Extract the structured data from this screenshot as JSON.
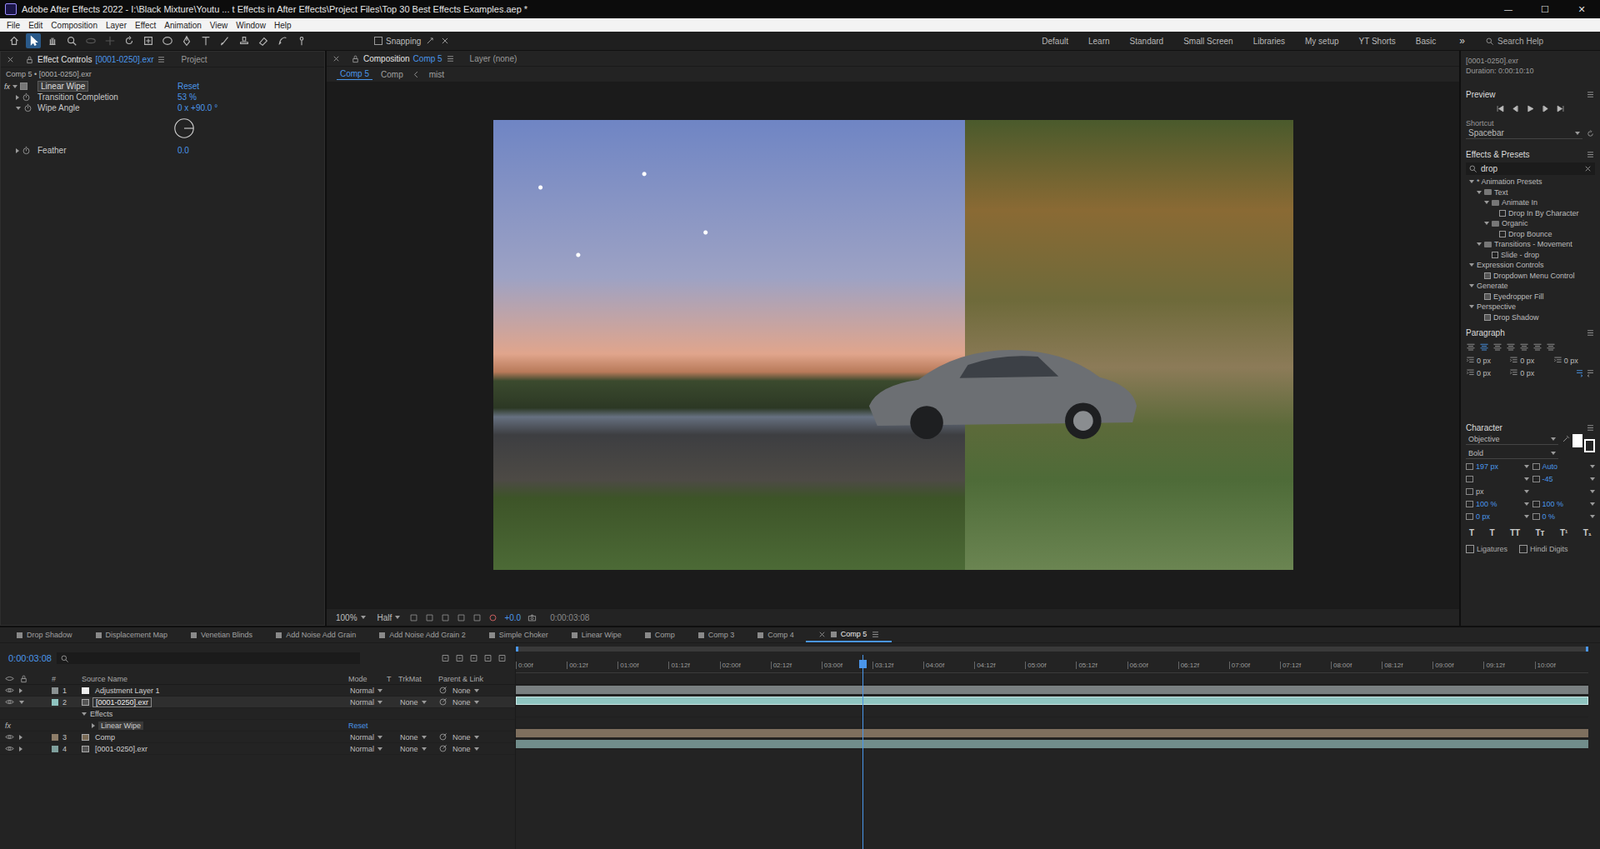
{
  "window": {
    "title": "Adobe After Effects 2022 - I:\\Black Mixture\\Youtu ... t Effects in After Effects\\Project Files\\Top 30 Best Effects Examples.aep *",
    "controls": [
      "—",
      "☐",
      "✕"
    ]
  },
  "menu": [
    "File",
    "Edit",
    "Composition",
    "Layer",
    "Effect",
    "Animation",
    "View",
    "Window",
    "Help"
  ],
  "toolbar": {
    "snapping": {
      "label": "Snapping",
      "checked": false
    },
    "workspaces": [
      {
        "label": "Default",
        "selected": false
      },
      {
        "label": "Learn",
        "selected": false
      },
      {
        "label": "Standard",
        "selected": false
      },
      {
        "label": "Small Screen",
        "selected": false
      },
      {
        "label": "Libraries",
        "selected": false
      },
      {
        "label": "My setup",
        "selected": false
      },
      {
        "label": "YT Shorts",
        "selected": false
      },
      {
        "label": "Basic",
        "selected": false
      }
    ],
    "more": "»",
    "search": "Search Help"
  },
  "effect_controls": {
    "tabs": [
      {
        "label": "Effect Controls",
        "target": "[0001-0250].exr",
        "selected": true
      },
      {
        "label": "Project",
        "target": "",
        "selected": false
      }
    ],
    "layer_path": "Comp 5 • [0001-0250].exr",
    "effect": {
      "badge": "fx",
      "name": "Linear Wipe",
      "reset": "Reset",
      "enabled": true
    },
    "properties": [
      {
        "name": "Transition Completion",
        "value": "53 %",
        "kind": "value",
        "expanded": false
      },
      {
        "name": "Wipe Angle",
        "value": "0 x +90.0 °",
        "kind": "angle",
        "expanded": true
      },
      {
        "name": "Feather",
        "value": "0.0",
        "kind": "value",
        "expanded": false
      }
    ]
  },
  "composition": {
    "tabs": [
      {
        "label": "Composition",
        "target": "Comp 5",
        "selected": true
      },
      {
        "label": "Layer (none)",
        "target": "",
        "selected": false
      }
    ],
    "breadcrumbs": [
      {
        "label": "Comp 5",
        "selected": true
      },
      {
        "label": "Comp",
        "selected": false
      },
      {
        "label": "mist",
        "selected": false
      }
    ],
    "wipe_level": 0.59,
    "footer": {
      "zoom": "100%",
      "resolution": "Half",
      "exposure": "+0.0",
      "time": "0:00:03:08"
    }
  },
  "info": {
    "name": "[0001-0250].exr",
    "duration": "Duration: 0:00:10:10"
  },
  "preview": {
    "title": "Preview",
    "shortcut_label": "Shortcut",
    "shortcut": "Spacebar"
  },
  "effects_presets": {
    "title": "Effects & Presets",
    "search": "drop",
    "tree": [
      {
        "label": "* Animation Presets",
        "depth": 0,
        "kind": "category",
        "expanded": true
      },
      {
        "label": "Text",
        "depth": 1,
        "kind": "folder",
        "expanded": true
      },
      {
        "label": "Animate In",
        "depth": 2,
        "kind": "folder",
        "expanded": true
      },
      {
        "label": "Drop In By Character",
        "depth": 3,
        "kind": "preset",
        "expanded": false
      },
      {
        "label": "Organic",
        "depth": 2,
        "kind": "folder",
        "expanded": true
      },
      {
        "label": "Drop Bounce",
        "depth": 3,
        "kind": "preset",
        "expanded": false
      },
      {
        "label": "Transitions - Movement",
        "depth": 1,
        "kind": "folder",
        "expanded": true
      },
      {
        "label": "Slide - drop",
        "depth": 2,
        "kind": "preset",
        "expanded": false
      },
      {
        "label": "Expression Controls",
        "depth": 0,
        "kind": "category",
        "expanded": true
      },
      {
        "label": "Dropdown Menu Control",
        "depth": 1,
        "kind": "effect",
        "expanded": false
      },
      {
        "label": "Generate",
        "depth": 0,
        "kind": "category",
        "expanded": true
      },
      {
        "label": "Eyedropper Fill",
        "depth": 1,
        "kind": "effect",
        "expanded": false
      },
      {
        "label": "Perspective",
        "depth": 0,
        "kind": "category",
        "expanded": true
      },
      {
        "label": "Drop Shadow",
        "depth": 1,
        "kind": "effect",
        "expanded": false
      }
    ]
  },
  "paragraph": {
    "title": "Paragraph",
    "fields": [
      "0 px",
      "0 px",
      "0 px",
      "0 px",
      "0 px"
    ]
  },
  "character": {
    "title": "Character",
    "font": "Objective",
    "style": "Bold",
    "size": "197 px",
    "leading": "Auto",
    "tracking": "-45",
    "stroke_width": "px",
    "vertical_scale": "100 %",
    "horizontal_scale": "100 %",
    "baseline_shift": "0 px",
    "tsume": "0 %",
    "style_buttons": [
      "T",
      "T",
      "TT",
      "Tт",
      "T¹",
      "T₁"
    ],
    "options": [
      {
        "label": "Ligatures",
        "checked": false
      },
      {
        "label": "Hindi Digits",
        "checked": false
      }
    ]
  },
  "timeline": {
    "tabs": [
      {
        "label": "Drop Shadow",
        "selected": false
      },
      {
        "label": "Displacement Map",
        "selected": false
      },
      {
        "label": "Venetian Blinds",
        "selected": false
      },
      {
        "label": "Add Noise Add Grain",
        "selected": false
      },
      {
        "label": "Add Noise Add Grain 2",
        "selected": false
      },
      {
        "label": "Simple Choker",
        "selected": false
      },
      {
        "label": "Linear Wipe",
        "selected": false
      },
      {
        "label": "Comp",
        "selected": false
      },
      {
        "label": "Comp 3",
        "selected": false
      },
      {
        "label": "Comp 4",
        "selected": false
      },
      {
        "label": "Comp 5",
        "selected": true
      }
    ],
    "time": "0:00:03:08",
    "columns": [
      "#",
      "Source Name",
      "Mode",
      "T",
      "TrkMat",
      "Parent & Link"
    ],
    "rows": [
      {
        "kind": "layer",
        "num": "1",
        "source": "adjustment",
        "name": "Adjustment Layer 1",
        "mode": "Normal",
        "trkmat": "",
        "parent": "None",
        "selected": false,
        "expanded": false,
        "visible": true,
        "color": "#8a9192"
      },
      {
        "kind": "layer",
        "num": "2",
        "source": "footage",
        "name": "[0001-0250].exr",
        "mode": "Normal",
        "trkmat": "None",
        "parent": "None",
        "selected": true,
        "expanded": true,
        "visible": true,
        "color": "#8fc4c0"
      },
      {
        "kind": "group",
        "name": "Effects",
        "expanded": true
      },
      {
        "kind": "effect",
        "badge": "fx",
        "name": "Linear Wipe",
        "reset": "Reset"
      },
      {
        "kind": "layer",
        "num": "3",
        "source": "comp",
        "name": "Comp",
        "mode": "Normal",
        "trkmat": "None",
        "parent": "None",
        "selected": false,
        "expanded": false,
        "visible": true,
        "color": "#8e7d69"
      },
      {
        "kind": "layer",
        "num": "4",
        "source": "footage",
        "name": "[0001-0250].exr",
        "mode": "Normal",
        "trkmat": "None",
        "parent": "None",
        "selected": false,
        "expanded": false,
        "visible": true,
        "color": "#7fa09d"
      }
    ],
    "ruler": [
      "0:00f",
      "00:12f",
      "01:00f",
      "01:12f",
      "02:00f",
      "02:12f",
      "03:00f",
      "03:12f",
      "04:00f",
      "04:12f",
      "05:00f",
      "05:12f",
      "06:00f",
      "06:12f",
      "07:00f",
      "07:12f",
      "08:00f",
      "08:12f",
      "09:00f",
      "09:12f",
      "10:00f"
    ],
    "playhead_level": 0.32
  }
}
